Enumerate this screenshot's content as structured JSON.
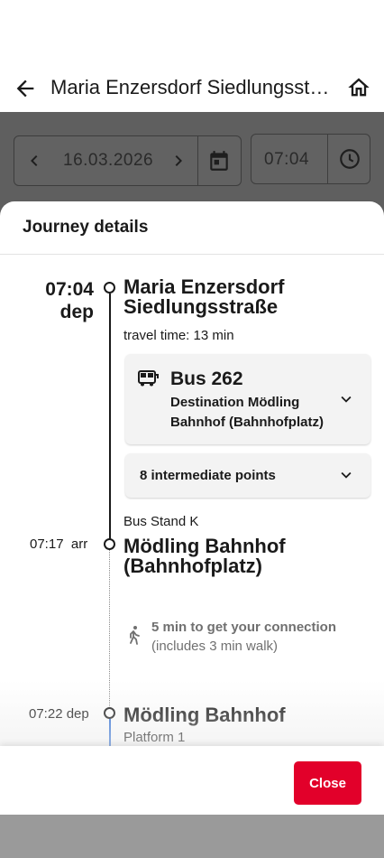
{
  "appbar": {
    "title": "Maria Enzersdorf Siedlungsstraße"
  },
  "search": {
    "date": "16.03.2026",
    "time": "07:04"
  },
  "sheet": {
    "title": "Journey details",
    "departure": {
      "time": "07:04",
      "suffix": "dep",
      "stop": "Maria Enzersdorf Siedlungsstraße",
      "travel_time": "travel time: 13 min"
    },
    "bus": {
      "name": "Bus 262",
      "destination": "Destination Mödling Bahnhof (Bahnhofplatz)"
    },
    "intermediate": "8 intermediate points",
    "arrival": {
      "stand": "Bus Stand K",
      "time": "07:17  arr",
      "stop": "Mödling Bahnhof (Bahnhofplatz)"
    },
    "connection": {
      "line1": "5 min to get your connection",
      "line2": "(includes 3 min walk)"
    },
    "next": {
      "time": "07:22 dep",
      "stop": "Mödling Bahnhof",
      "platform": "Platform 1"
    }
  },
  "footer": {
    "close_label": "Close"
  },
  "colors": {
    "accent": "#e2002a",
    "line_blue": "#2f6fd6"
  }
}
